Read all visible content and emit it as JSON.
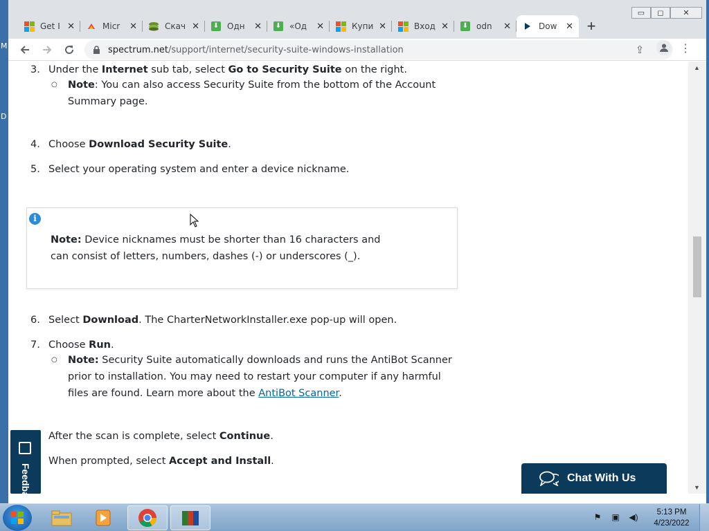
{
  "desktop": {
    "edge_letters": [
      "M",
      "D"
    ]
  },
  "browser": {
    "window_controls": {
      "minimize": "▭",
      "maximize": "◻",
      "close": "✕"
    },
    "tabs": [
      {
        "title": "Get I",
        "icon": "microsoft-logo"
      },
      {
        "title": "Micr",
        "icon": "edge-cloud-icon"
      },
      {
        "title": "Скач",
        "icon": "stack-icon"
      },
      {
        "title": "Одн",
        "icon": "download-green-icon"
      },
      {
        "title": "«Од",
        "icon": "download-green-icon"
      },
      {
        "title": "Купи",
        "icon": "microsoft-logo"
      },
      {
        "title": "Вход",
        "icon": "microsoft-logo"
      },
      {
        "title": "odn",
        "icon": "download-green-icon"
      },
      {
        "title": "Dow",
        "icon": "play-icon",
        "active": true
      }
    ],
    "new_tab": "+",
    "url_domain": "spectrum.net",
    "url_path": "/support/internet/security-suite-windows-installation"
  },
  "content": {
    "step3": {
      "num": "3.",
      "pre": "Under the ",
      "b1": "Internet",
      "mid": " sub tab, select ",
      "b2": "Go to Security Suite",
      "post": " on the right."
    },
    "step3_note": {
      "label": "Note",
      "text": ": You can also access Security Suite from the bottom of the Account Summary page."
    },
    "step4": {
      "num": "4.",
      "pre": "Choose ",
      "b1": "Download Security Suite",
      "post": "."
    },
    "step5": {
      "num": "5.",
      "text": "Select your operating system and enter a device nickname."
    },
    "notebox": {
      "label": "Note:",
      "text": " Device nicknames must be shorter than 16 characters and can consist of letters, numbers, dashes (-) or underscores (_)."
    },
    "step6": {
      "num": "6.",
      "pre": "Select ",
      "b1": "Download",
      "post": ". The CharterNetworkInstaller.exe pop-up will open."
    },
    "step7": {
      "num": "7.",
      "pre": "Choose ",
      "b1": "Run",
      "post": "."
    },
    "step7_note": {
      "label": "Note:",
      "text": "  Security Suite automatically downloads and runs the AntiBot Scanner prior to installation. You may need to restart your computer if any harmful files are found. Learn more about the ",
      "link": "AntiBot Scanner",
      "post": "."
    },
    "after1": {
      "pre": "After the scan is complete, select ",
      "b1": "Continue",
      "post": "."
    },
    "after2": {
      "pre": "When prompted, select ",
      "b1": "Accept and Install",
      "post": "."
    }
  },
  "widgets": {
    "feedback_label": "Feedback",
    "chat_label": "Chat With Us"
  },
  "taskbar": {
    "time": "5:13 PM",
    "date": "4/23/2022"
  },
  "colors": {
    "brand_navy": "#0b3a5a",
    "link": "#0066a8",
    "info_blue": "#2e8bd6"
  }
}
